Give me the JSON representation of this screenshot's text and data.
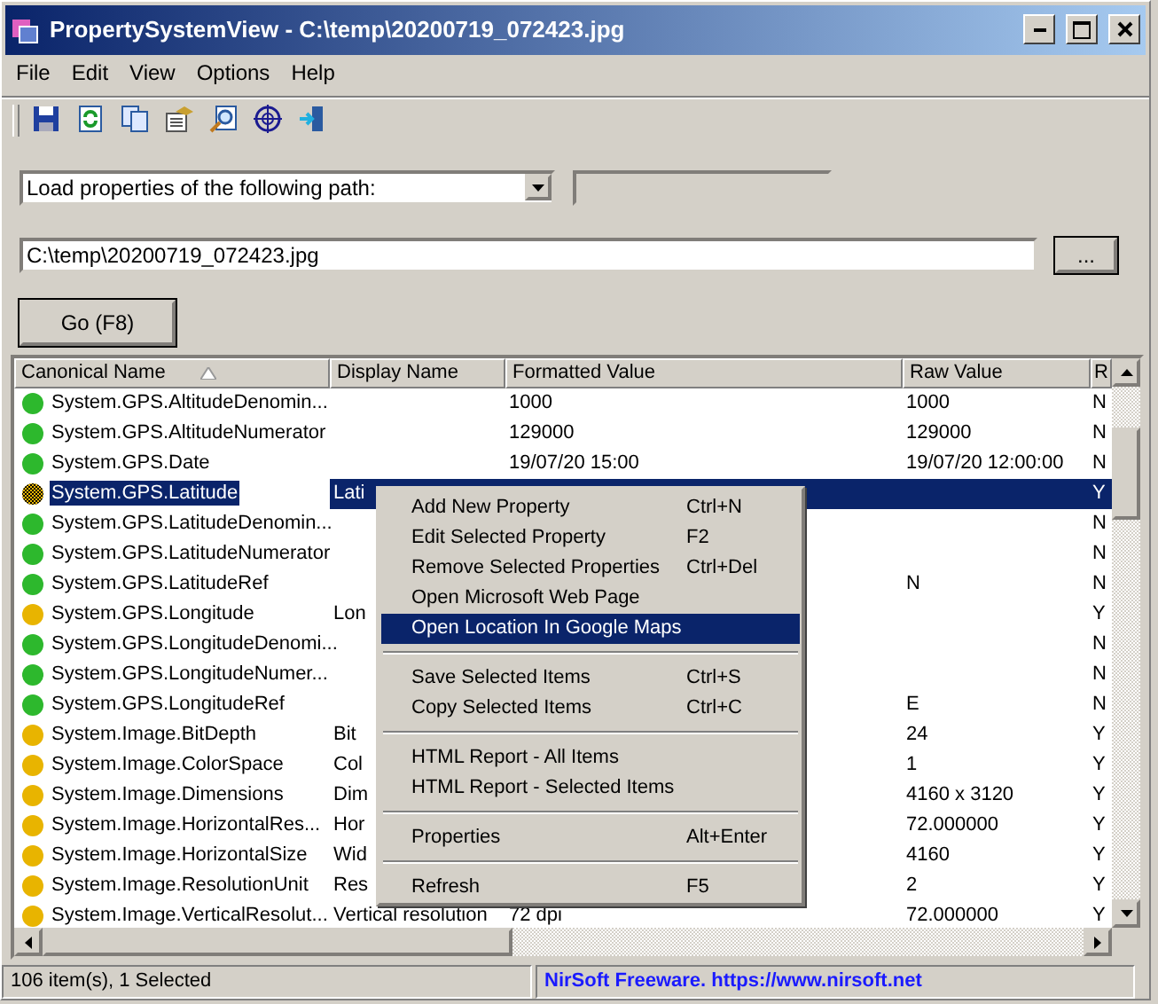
{
  "window": {
    "title": "PropertySystemView  -  C:\\temp\\20200719_072423.jpg"
  },
  "menu": [
    "File",
    "Edit",
    "View",
    "Options",
    "Help"
  ],
  "toolbar": [
    {
      "kind": "save"
    },
    {
      "kind": "refresh"
    },
    {
      "kind": "copy"
    },
    {
      "kind": "properties"
    },
    {
      "kind": "find"
    },
    {
      "kind": "target"
    },
    {
      "kind": "exit"
    }
  ],
  "load_mode": {
    "value": "Load properties of the following path:"
  },
  "path": {
    "value": "C:\\temp\\20200719_072423.jpg"
  },
  "browse_button": "...",
  "go_button": "Go (F8)",
  "table": {
    "columns": [
      {
        "label": "Canonical Name",
        "sorted": true
      },
      {
        "label": "Display Name",
        "sorted": false
      },
      {
        "label": "Formatted Value",
        "sorted": false
      },
      {
        "label": "Raw Value",
        "sorted": false
      },
      {
        "label": "R"
      }
    ],
    "rows": [
      {
        "cells": [
          "System.GPS.AltitudeDenomin...",
          "",
          "1000",
          "1000",
          "N"
        ],
        "color": "#2db82d",
        "selected": false
      },
      {
        "cells": [
          "System.GPS.AltitudeNumerator",
          "",
          "129000",
          "129000",
          "N"
        ],
        "color": "#2db82d",
        "selected": false
      },
      {
        "cells": [
          "System.GPS.Date",
          "",
          "19/07/20 15:00",
          "19/07/20 12:00:00",
          "N"
        ],
        "color": "#2db82d",
        "selected": false
      },
      {
        "cells": [
          "System.GPS.Latitude",
          "Lati",
          "",
          "",
          "Y"
        ],
        "color": "#e8b400",
        "selected": true
      },
      {
        "cells": [
          "System.GPS.LatitudeDenomin...",
          "",
          "",
          "",
          "N"
        ],
        "color": "#2db82d",
        "selected": false
      },
      {
        "cells": [
          "System.GPS.LatitudeNumerator",
          "",
          "",
          "",
          "N"
        ],
        "color": "#2db82d",
        "selected": false
      },
      {
        "cells": [
          "System.GPS.LatitudeRef",
          "",
          "",
          "N",
          "N"
        ],
        "color": "#2db82d",
        "selected": false
      },
      {
        "cells": [
          "System.GPS.Longitude",
          "Lon",
          "",
          "",
          "Y"
        ],
        "color": "#e8b400",
        "selected": false
      },
      {
        "cells": [
          "System.GPS.LongitudeDenomi...",
          "",
          "",
          "",
          "N"
        ],
        "color": "#2db82d",
        "selected": false
      },
      {
        "cells": [
          "System.GPS.LongitudeNumer...",
          "",
          "",
          "",
          "N"
        ],
        "color": "#2db82d",
        "selected": false
      },
      {
        "cells": [
          "System.GPS.LongitudeRef",
          "",
          "",
          "E",
          "N"
        ],
        "color": "#2db82d",
        "selected": false
      },
      {
        "cells": [
          "System.Image.BitDepth",
          "Bit",
          "",
          "24",
          "Y"
        ],
        "color": "#e8b400",
        "selected": false
      },
      {
        "cells": [
          "System.Image.ColorSpace",
          "Col",
          "",
          "1",
          "Y"
        ],
        "color": "#e8b400",
        "selected": false
      },
      {
        "cells": [
          "System.Image.Dimensions",
          "Dim",
          "",
          "4160 x 3120",
          "Y"
        ],
        "color": "#e8b400",
        "selected": false
      },
      {
        "cells": [
          "System.Image.HorizontalRes...",
          "Hor",
          "",
          "72.000000",
          "Y"
        ],
        "color": "#e8b400",
        "selected": false
      },
      {
        "cells": [
          "System.Image.HorizontalSize",
          "Wid",
          "",
          "4160",
          "Y"
        ],
        "color": "#e8b400",
        "selected": false
      },
      {
        "cells": [
          "System.Image.ResolutionUnit",
          "Res",
          "",
          "2",
          "Y"
        ],
        "color": "#e8b400",
        "selected": false
      },
      {
        "cells": [
          "System.Image.VerticalResolut...",
          "Vertical resolution",
          "72 dpi",
          "72.000000",
          "Y"
        ],
        "color": "#e8b400",
        "selected": false
      }
    ]
  },
  "context_menu": [
    {
      "kind": "item",
      "label": "Add New Property",
      "shortcut": "Ctrl+N",
      "selected": false
    },
    {
      "kind": "item",
      "label": "Edit Selected Property",
      "shortcut": "F2",
      "selected": false
    },
    {
      "kind": "item",
      "label": "Remove Selected Properties",
      "shortcut": "Ctrl+Del",
      "selected": false
    },
    {
      "kind": "item",
      "label": "Open Microsoft Web Page",
      "selected": false
    },
    {
      "kind": "item",
      "label": "Open Location In Google Maps",
      "selected": true
    },
    {
      "kind": "separator"
    },
    {
      "kind": "item",
      "label": "Save Selected Items",
      "shortcut": "Ctrl+S",
      "selected": false
    },
    {
      "kind": "item",
      "label": "Copy Selected Items",
      "shortcut": "Ctrl+C",
      "selected": false
    },
    {
      "kind": "separator"
    },
    {
      "kind": "item",
      "label": "HTML Report - All Items",
      "selected": false
    },
    {
      "kind": "item",
      "label": "HTML Report - Selected Items",
      "selected": false
    },
    {
      "kind": "separator"
    },
    {
      "kind": "item",
      "label": "Properties",
      "shortcut": "Alt+Enter",
      "selected": false
    },
    {
      "kind": "separator"
    },
    {
      "kind": "item",
      "label": "Refresh",
      "shortcut": "F5",
      "selected": false
    }
  ],
  "status_bar": {
    "count": "106 item(s), 1 Selected",
    "link": "NirSoft Freeware. https://www.nirsoft.net"
  }
}
